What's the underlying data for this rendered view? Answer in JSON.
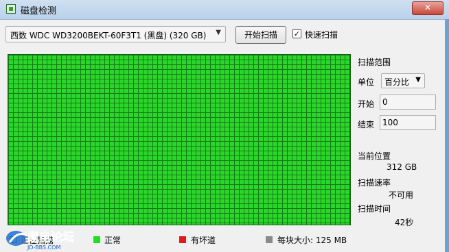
{
  "window": {
    "title": "磁盘检测",
    "close_glyph": "✕"
  },
  "toolbar": {
    "disk_select_value": "西数 WDC WD3200BEKT-60F3T1 (黑盘)  (320 GB)",
    "scan_button": "开始扫描",
    "quick_scan_checked": true,
    "quick_scan_label": "快速扫描"
  },
  "scan_range": {
    "heading": "扫描范围",
    "unit_label": "单位",
    "unit_value": "百分比",
    "start_label": "开始",
    "start_value": "0",
    "end_label": "结束",
    "end_value": "100"
  },
  "status": {
    "position_label": "当前位置",
    "position_value": "312 GB",
    "speed_label": "扫描速率",
    "speed_value": "不可用",
    "time_label": "扫描时间",
    "time_value": "42秒"
  },
  "legend": {
    "in_progress": "正在扫描",
    "normal": "正常",
    "bad": "有坏道",
    "block_size": "每块大小: 125 MB"
  },
  "colors": {
    "normal": "#1ee21e",
    "bad": "#e11b1b",
    "block_size": "#8a8a8a",
    "in_progress": "#ffffff"
  },
  "watermark": {
    "text": "家电论坛",
    "url": "JD-BBS.COM"
  }
}
